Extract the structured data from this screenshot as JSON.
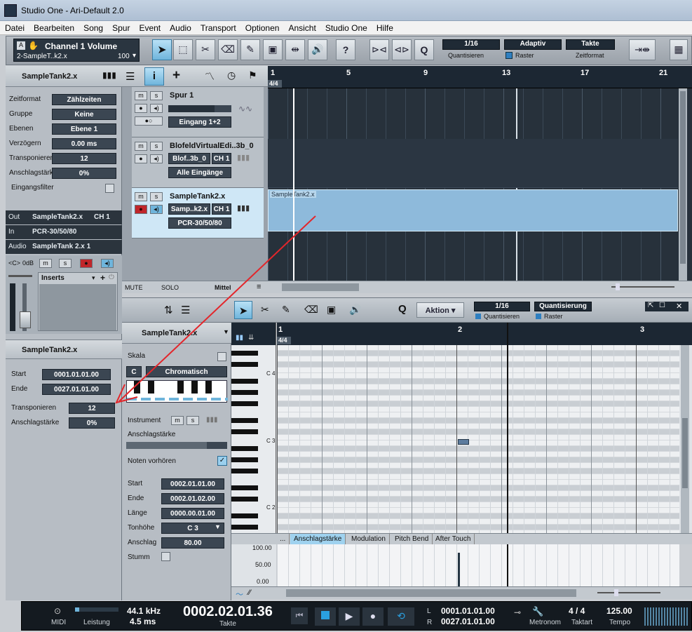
{
  "window": {
    "title": "Studio One - Ari-Default 2.0"
  },
  "menu": [
    "Datei",
    "Bearbeiten",
    "Song",
    "Spur",
    "Event",
    "Audio",
    "Transport",
    "Optionen",
    "Ansicht",
    "Studio One",
    "Hilfe"
  ],
  "toolbar": {
    "param_name": "Channel 1 Volume",
    "param_track": "2-SampleT..k2.x",
    "param_value": "100",
    "help": "?",
    "quant_value": "1/16",
    "quant_label": "Quantisieren",
    "raster_value": "Adaptiv",
    "raster_label": "Raster",
    "timeformat_value": "Takte",
    "timeformat_label": "Zeitformat"
  },
  "inspector": {
    "track_title": "SampleTank2.x",
    "rows": [
      {
        "label": "Zeitformat",
        "value": "Zählzeiten"
      },
      {
        "label": "Gruppe",
        "value": "Keine"
      },
      {
        "label": "Ebenen",
        "value": "Ebene 1"
      },
      {
        "label": "Verzögern",
        "value": "0.00 ms"
      },
      {
        "label": "Transponieren",
        "value": "12"
      },
      {
        "label": "Anschlagstärke",
        "value": "0%"
      }
    ],
    "input_filter": "Eingangsfilter",
    "out_label": "Out",
    "out_value": "SampleTank2.x",
    "out_ch": "CH 1",
    "in_label": "In",
    "in_value": "PCR-30/50/80",
    "audio_label": "Audio",
    "audio_value": "SampleTank 2.x 1",
    "pan": "<C>",
    "gain": "0dB",
    "inserts": "Inserts",
    "event_title": "SampleTank2.x",
    "event_rows": [
      {
        "label": "Start",
        "value": "0001.01.01.00"
      },
      {
        "label": "Ende",
        "value": "0027.01.01.00"
      },
      {
        "label": "Transponieren",
        "value": "12"
      },
      {
        "label": "Anschlagstärke",
        "value": "0%"
      }
    ]
  },
  "tracks": [
    {
      "name": "Spur 1",
      "input": "Eingang 1+2",
      "device": "",
      "channel": ""
    },
    {
      "name": "BlofeldVirtualEdi..3b_0",
      "device": "Blof..3b_0",
      "channel": "CH 1",
      "input": "Alle Eingänge"
    },
    {
      "name": "SampleTank2.x",
      "device": "Samp..k2.x",
      "channel": "CH 1",
      "input": "PCR-30/50/80"
    }
  ],
  "arrange": {
    "ruler": [
      "1",
      "5",
      "9",
      "13",
      "17",
      "21"
    ],
    "time_sig": "4/4",
    "event_label": "SampleTank2.x",
    "mute": "MUTE",
    "solo": "SOLO",
    "mode": "Mittel"
  },
  "editor": {
    "action": "Aktion",
    "quant_value": "1/16",
    "quant_label": "Quantisieren",
    "quant_btn": "Quantisierung",
    "raster_label": "Raster",
    "instrument_title": "SampleTank2.x",
    "scale_label": "Skala",
    "scale_root": "C",
    "scale_value": "Chromatisch",
    "instrument_label": "Instrument",
    "velocity_label": "Anschlagstärke",
    "preview_label": "Noten vorhören",
    "note_rows": [
      {
        "label": "Start",
        "value": "0002.01.01.00"
      },
      {
        "label": "Ende",
        "value": "0002.01.02.00"
      },
      {
        "label": "Länge",
        "value": "0000.00.01.00"
      },
      {
        "label": "Tonhöhe",
        "value": "C 3"
      },
      {
        "label": "Anschlag",
        "value": "80.00"
      },
      {
        "label": "Stumm",
        "value": ""
      }
    ],
    "ruler": [
      "1",
      "2",
      "3"
    ],
    "time_sig": "4/4",
    "key_labels": [
      "C 4",
      "C 3",
      "C 2"
    ],
    "lanes": [
      "...",
      "Anschlagstärke",
      "Modulation",
      "Pitch Bend",
      "After Touch"
    ],
    "vel_scale": [
      "100.00",
      "50.00",
      "0.00"
    ]
  },
  "transport": {
    "midi": "MIDI",
    "perf": "Leistung",
    "sample_rate": "44.1 kHz",
    "latency": "4.5 ms",
    "position": "0002.02.01.36",
    "pos_label": "Takte",
    "loop_l_label": "L",
    "loop_l": "0001.01.01.00",
    "loop_r_label": "R",
    "loop_r": "0027.01.01.00",
    "metronome": "Metronom",
    "timesig": "4  /  4",
    "timesig_label": "Taktart",
    "tempo": "125.00",
    "tempo_label": "Tempo"
  },
  "colors": {
    "accent": "#6fb5dc",
    "record": "#c0262b",
    "ruler": "#1c2733",
    "annotation": "#e3262b"
  }
}
